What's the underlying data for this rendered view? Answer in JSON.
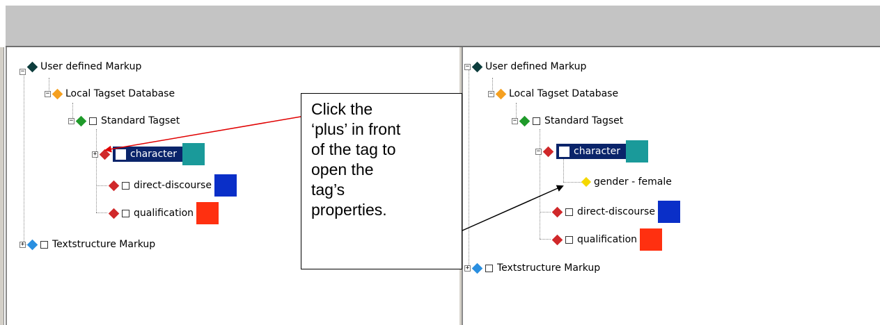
{
  "left_tree": {
    "root": "User defined Markup",
    "database": "Local Tagset Database",
    "tagset": "Standard Tagset",
    "tags": [
      "character",
      "direct-discourse",
      "qualification"
    ],
    "textstructure": "Textstructure Markup"
  },
  "right_tree": {
    "root": "User defined Markup",
    "database": "Local Tagset Database",
    "tagset": "Standard Tagset",
    "tags": [
      "character",
      "direct-discourse",
      "qualification"
    ],
    "property": "gender - female",
    "textstructure": "Textstructure Markup"
  },
  "callout": {
    "lines": [
      "Click the",
      "‘plus’ in front",
      "of the tag to",
      "open the",
      "tag’s",
      "properties."
    ]
  },
  "colors": {
    "selection": "#0a246a",
    "character_swatch": "#1a9a9a",
    "direct_discourse_swatch": "#0a2fc8",
    "qualification_swatch": "#ff3010",
    "arrow_red": "#e00000",
    "arrow_black": "#000000"
  },
  "icons": {
    "root": "dark-teal-diamond-icon",
    "database": "orange-diamond-icon",
    "tagset": "green-diamond-icon",
    "tag": "red-diamond-icon",
    "property": "yellow-diamond-icon",
    "textstructure": "blue-diamond-icon"
  }
}
